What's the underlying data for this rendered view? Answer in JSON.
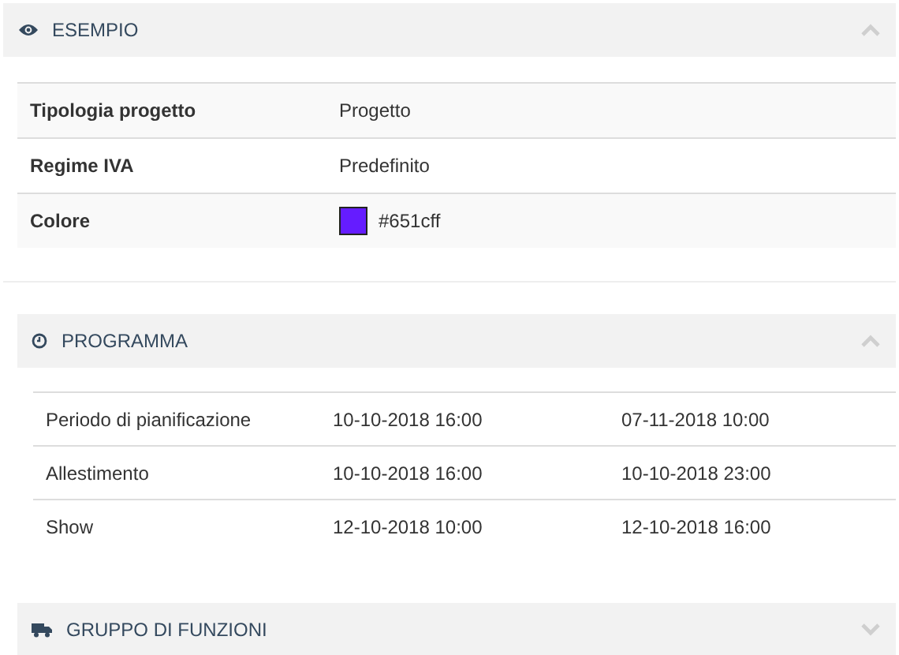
{
  "sections": [
    {
      "title": "ESEMPIO",
      "expanded": true,
      "kind": "properties",
      "rows": [
        {
          "label": "Tipologia progetto",
          "value": "Progetto"
        },
        {
          "label": "Regime IVA",
          "value": "Predefinito"
        },
        {
          "label": "Colore",
          "value": "#651cff",
          "color": "#651cff"
        }
      ]
    },
    {
      "title": "PROGRAMMA",
      "expanded": true,
      "kind": "schedule",
      "rows": [
        {
          "label": "Periodo di pianificazione",
          "start": "10-10-2018 16:00",
          "end": "07-11-2018 10:00"
        },
        {
          "label": "Allestimento",
          "start": "10-10-2018 16:00",
          "end": "10-10-2018 23:00"
        },
        {
          "label": "Show",
          "start": "12-10-2018 10:00",
          "end": "12-10-2018 16:00"
        }
      ]
    },
    {
      "title": "GRUPPO DI FUNZIONI",
      "expanded": false
    }
  ]
}
